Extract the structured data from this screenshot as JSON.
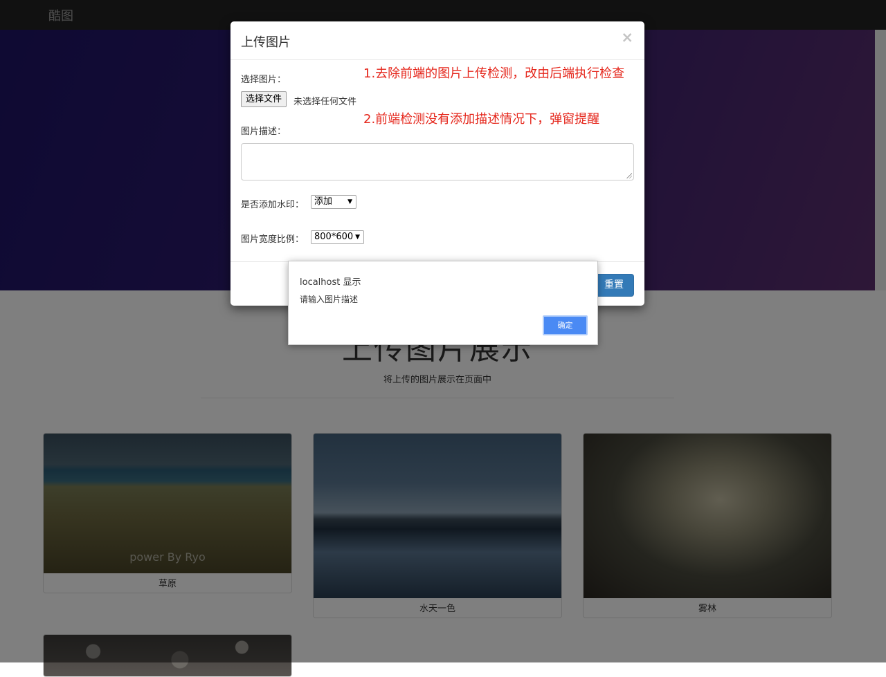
{
  "navbar": {
    "brand": "酷图"
  },
  "gallery": {
    "title": "上传图片展示",
    "subtitle": "将上传的图片展示在页面中",
    "watermark": "power By Ryo",
    "cards": [
      {
        "caption": "草原"
      },
      {
        "caption": "水天一色"
      },
      {
        "caption": "雾林"
      }
    ]
  },
  "modal": {
    "title": "上传图片",
    "close_glyph": "×",
    "file_label": "选择图片：",
    "file_button": "选择文件",
    "file_status": "未选择任何文件",
    "desc_label": "图片描述：",
    "desc_value": "",
    "watermark_label": "是否添加水印：",
    "watermark_selected": "添加",
    "ratio_label": "图片宽度比例：",
    "ratio_selected": "800*600",
    "reset_button": "重置",
    "notes": [
      "1.去除前端的图片上传检测，改由后端执行检查",
      "2.前端检测没有添加描述情况下，弹窗提醒"
    ]
  },
  "alert": {
    "origin": "localhost 显示",
    "message": "请输入图片描述",
    "ok_button": "确定"
  },
  "colors": {
    "note_red": "#e5271c",
    "primary_blue": "#337ab7",
    "alert_button_blue": "#4a8af4"
  }
}
